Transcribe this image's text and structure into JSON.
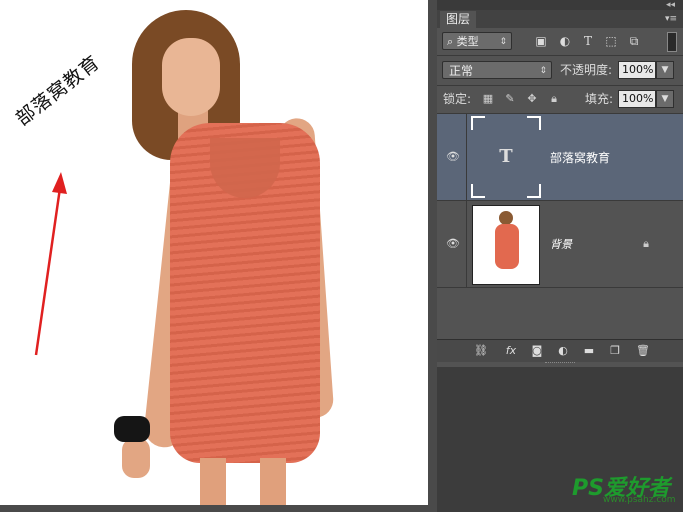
{
  "canvas": {
    "overlay_text": "部落窝教育"
  },
  "panel": {
    "tab_label": "图层",
    "filter": {
      "label": "类型",
      "icon": "search-icon"
    },
    "blend_mode": "正常",
    "opacity_label": "不透明度:",
    "opacity_value": "100%",
    "lock_label": "锁定:",
    "fill_label": "填充:",
    "fill_value": "100%",
    "layers": [
      {
        "name": "部落窝教育",
        "type": "text",
        "selected": true,
        "visible": true
      },
      {
        "name": "背景",
        "type": "image",
        "selected": false,
        "visible": true,
        "locked": true
      }
    ]
  },
  "watermark": {
    "text": "PS爱好者",
    "url": "www.psahz.com"
  },
  "colors": {
    "panel_bg": "#535353",
    "selected_layer": "#5b6678",
    "dress": "#e2694f",
    "arrow": "#e02020",
    "watermark": "#1e9b2d"
  }
}
